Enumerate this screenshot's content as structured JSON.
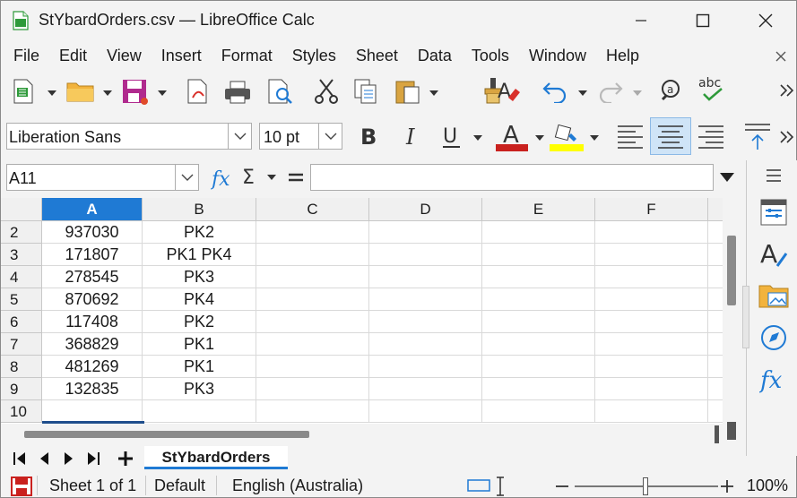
{
  "window": {
    "title": "StYbardOrders.csv — LibreOffice Calc"
  },
  "menu": [
    "File",
    "Edit",
    "View",
    "Insert",
    "Format",
    "Styles",
    "Sheet",
    "Data",
    "Tools",
    "Window",
    "Help"
  ],
  "font": {
    "name": "Liberation Sans",
    "size": "10 pt"
  },
  "namebox": {
    "value": "A11"
  },
  "formula": {
    "value": ""
  },
  "columns": [
    "A",
    "B",
    "C",
    "D",
    "E",
    "F"
  ],
  "rows": [
    {
      "num": "2",
      "a": "937030",
      "b": "PK2"
    },
    {
      "num": "3",
      "a": "171807",
      "b": "PK1 PK4"
    },
    {
      "num": "4",
      "a": "278545",
      "b": "PK3"
    },
    {
      "num": "5",
      "a": "870692",
      "b": "PK4"
    },
    {
      "num": "6",
      "a": "117408",
      "b": "PK2"
    },
    {
      "num": "7",
      "a": "368829",
      "b": "PK1"
    },
    {
      "num": "8",
      "a": "481269",
      "b": "PK1"
    },
    {
      "num": "9",
      "a": "132835",
      "b": "PK3"
    },
    {
      "num": "10",
      "a": "",
      "b": ""
    }
  ],
  "sheet": {
    "tab": "StYbardOrders"
  },
  "status": {
    "sheet": "Sheet 1 of 1",
    "style": "Default",
    "language": "English (Australia)",
    "zoom": "100%"
  },
  "colors": {
    "accent": "#1f7ad4",
    "font_color": "#c9211e",
    "highlight": "#ffff00"
  }
}
